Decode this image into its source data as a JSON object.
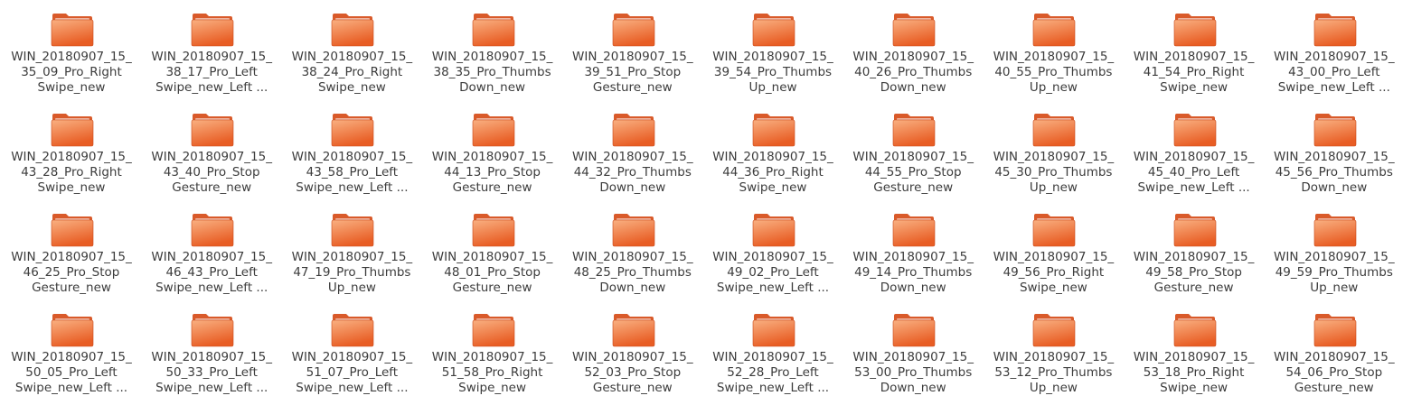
{
  "folder_icon": {
    "name": "folder-icon",
    "back_color": "#d95a2a",
    "front_color_light": "#f9b081",
    "front_color_dark": "#e85d24",
    "edge_color": "#c94818"
  },
  "folders": [
    {
      "line1": "WIN_20180907_15_",
      "line2": "35_09_Pro_Right",
      "line3": "Swipe_new"
    },
    {
      "line1": "WIN_20180907_15_",
      "line2": "38_17_Pro_Left",
      "line3": "Swipe_new_Left ..."
    },
    {
      "line1": "WIN_20180907_15_",
      "line2": "38_24_Pro_Right",
      "line3": "Swipe_new"
    },
    {
      "line1": "WIN_20180907_15_",
      "line2": "38_35_Pro_Thumbs",
      "line3": "Down_new"
    },
    {
      "line1": "WIN_20180907_15_",
      "line2": "39_51_Pro_Stop",
      "line3": "Gesture_new"
    },
    {
      "line1": "WIN_20180907_15_",
      "line2": "39_54_Pro_Thumbs",
      "line3": "Up_new"
    },
    {
      "line1": "WIN_20180907_15_",
      "line2": "40_26_Pro_Thumbs",
      "line3": "Down_new"
    },
    {
      "line1": "WIN_20180907_15_",
      "line2": "40_55_Pro_Thumbs",
      "line3": "Up_new"
    },
    {
      "line1": "WIN_20180907_15_",
      "line2": "41_54_Pro_Right",
      "line3": "Swipe_new"
    },
    {
      "line1": "WIN_20180907_15_",
      "line2": "43_00_Pro_Left",
      "line3": "Swipe_new_Left ..."
    },
    {
      "line1": "WIN_20180907_15_",
      "line2": "43_28_Pro_Right",
      "line3": "Swipe_new"
    },
    {
      "line1": "WIN_20180907_15_",
      "line2": "43_40_Pro_Stop",
      "line3": "Gesture_new"
    },
    {
      "line1": "WIN_20180907_15_",
      "line2": "43_58_Pro_Left",
      "line3": "Swipe_new_Left ..."
    },
    {
      "line1": "WIN_20180907_15_",
      "line2": "44_13_Pro_Stop",
      "line3": "Gesture_new"
    },
    {
      "line1": "WIN_20180907_15_",
      "line2": "44_32_Pro_Thumbs",
      "line3": "Down_new"
    },
    {
      "line1": "WIN_20180907_15_",
      "line2": "44_36_Pro_Right",
      "line3": "Swipe_new"
    },
    {
      "line1": "WIN_20180907_15_",
      "line2": "44_55_Pro_Stop",
      "line3": "Gesture_new"
    },
    {
      "line1": "WIN_20180907_15_",
      "line2": "45_30_Pro_Thumbs",
      "line3": "Up_new"
    },
    {
      "line1": "WIN_20180907_15_",
      "line2": "45_40_Pro_Left",
      "line3": "Swipe_new_Left ..."
    },
    {
      "line1": "WIN_20180907_15_",
      "line2": "45_56_Pro_Thumbs",
      "line3": "Down_new"
    },
    {
      "line1": "WIN_20180907_15_",
      "line2": "46_25_Pro_Stop",
      "line3": "Gesture_new"
    },
    {
      "line1": "WIN_20180907_15_",
      "line2": "46_43_Pro_Left",
      "line3": "Swipe_new_Left ..."
    },
    {
      "line1": "WIN_20180907_15_",
      "line2": "47_19_Pro_Thumbs",
      "line3": "Up_new"
    },
    {
      "line1": "WIN_20180907_15_",
      "line2": "48_01_Pro_Stop",
      "line3": "Gesture_new"
    },
    {
      "line1": "WIN_20180907_15_",
      "line2": "48_25_Pro_Thumbs",
      "line3": "Down_new"
    },
    {
      "line1": "WIN_20180907_15_",
      "line2": "49_02_Pro_Left",
      "line3": "Swipe_new_Left ..."
    },
    {
      "line1": "WIN_20180907_15_",
      "line2": "49_14_Pro_Thumbs",
      "line3": "Down_new"
    },
    {
      "line1": "WIN_20180907_15_",
      "line2": "49_56_Pro_Right",
      "line3": "Swipe_new"
    },
    {
      "line1": "WIN_20180907_15_",
      "line2": "49_58_Pro_Stop",
      "line3": "Gesture_new"
    },
    {
      "line1": "WIN_20180907_15_",
      "line2": "49_59_Pro_Thumbs",
      "line3": "Up_new"
    },
    {
      "line1": "WIN_20180907_15_",
      "line2": "50_05_Pro_Left",
      "line3": "Swipe_new_Left ..."
    },
    {
      "line1": "WIN_20180907_15_",
      "line2": "50_33_Pro_Left",
      "line3": "Swipe_new_Left ..."
    },
    {
      "line1": "WIN_20180907_15_",
      "line2": "51_07_Pro_Left",
      "line3": "Swipe_new_Left ..."
    },
    {
      "line1": "WIN_20180907_15_",
      "line2": "51_58_Pro_Right",
      "line3": "Swipe_new"
    },
    {
      "line1": "WIN_20180907_15_",
      "line2": "52_03_Pro_Stop",
      "line3": "Gesture_new"
    },
    {
      "line1": "WIN_20180907_15_",
      "line2": "52_28_Pro_Left",
      "line3": "Swipe_new_Left ..."
    },
    {
      "line1": "WIN_20180907_15_",
      "line2": "53_00_Pro_Thumbs",
      "line3": "Down_new"
    },
    {
      "line1": "WIN_20180907_15_",
      "line2": "53_12_Pro_Thumbs",
      "line3": "Up_new"
    },
    {
      "line1": "WIN_20180907_15_",
      "line2": "53_18_Pro_Right",
      "line3": "Swipe_new"
    },
    {
      "line1": "WIN_20180907_15_",
      "line2": "54_06_Pro_Stop",
      "line3": "Gesture_new"
    }
  ]
}
